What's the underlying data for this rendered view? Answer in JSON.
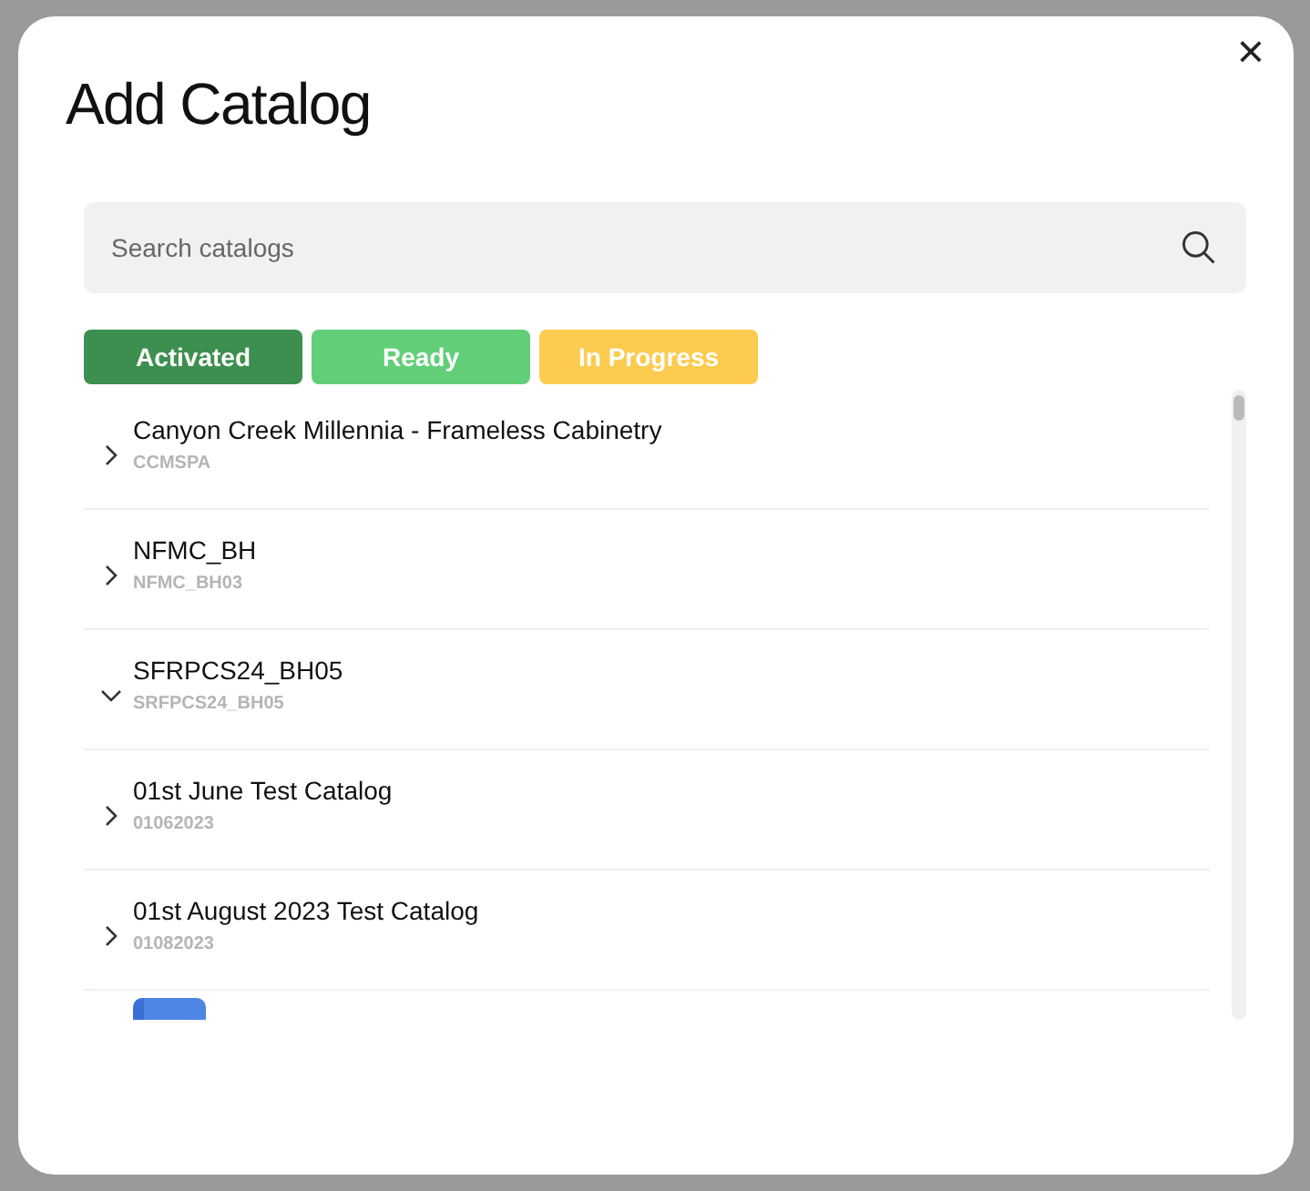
{
  "dialog": {
    "title": "Add Catalog",
    "close": "×"
  },
  "search": {
    "placeholder": "Search catalogs"
  },
  "filters": [
    {
      "label": "Activated",
      "color": "#3d8f4f"
    },
    {
      "label": "Ready",
      "color": "#62cf78"
    },
    {
      "label": "In Progress",
      "color": "#fccb4f"
    }
  ],
  "catalogs": [
    {
      "name": "Canyon Creek Millennia - Frameless Cabinetry",
      "code": "CCMSPA",
      "expanded": false
    },
    {
      "name": "NFMC_BH",
      "code": "NFMC_BH03",
      "expanded": false
    },
    {
      "name": "SFRPCS24_BH05",
      "code": "SRFPCS24_BH05",
      "expanded": true
    },
    {
      "name": "01st June Test Catalog",
      "code": "01062023",
      "expanded": false
    },
    {
      "name": "01st August 2023 Test Catalog",
      "code": "01082023",
      "expanded": false
    }
  ]
}
